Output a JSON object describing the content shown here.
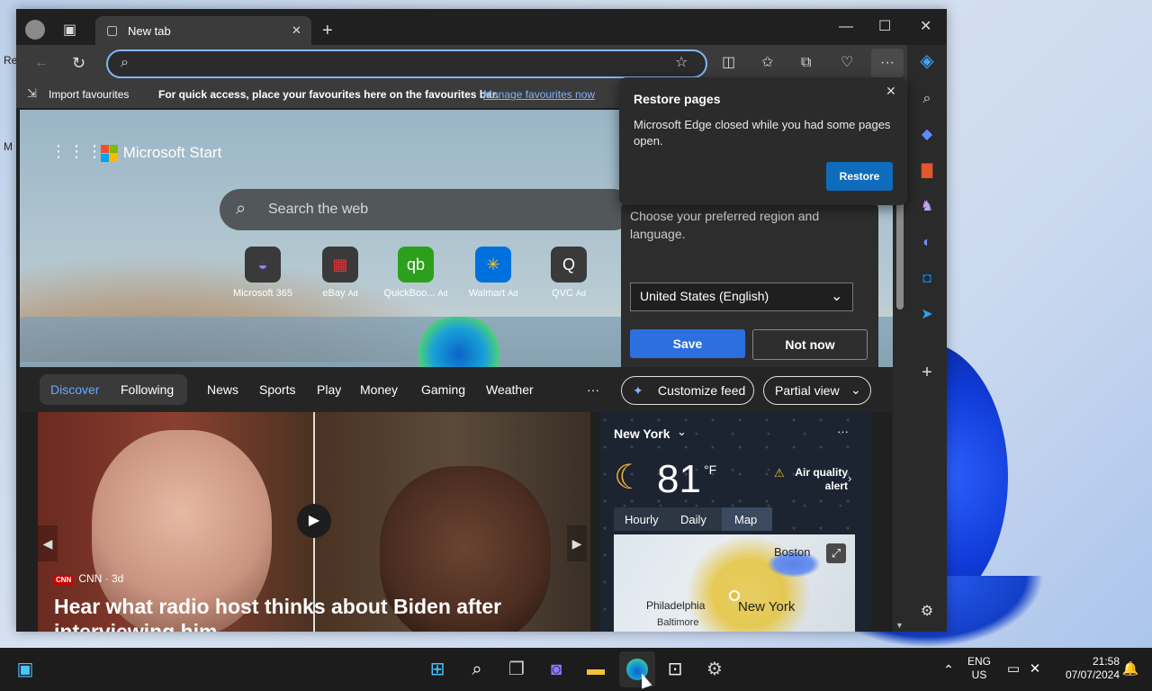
{
  "desktop": {
    "icon_labels": [
      "Re",
      "M"
    ]
  },
  "browser": {
    "tab": {
      "title": "New tab"
    },
    "address": {
      "placeholder": ""
    },
    "favbar": {
      "import_label": "Import favourites",
      "hint": "For quick access, place your favourites here on the favourites bar.",
      "manage_link": "Manage favourites now"
    }
  },
  "page": {
    "brand": "Microsoft Start",
    "search_placeholder": "Search the web",
    "tiles": [
      {
        "label": "Microsoft 365",
        "icon": "m365-icon",
        "ad": ""
      },
      {
        "label": "eBay",
        "icon": "ebay-icon",
        "ad": "Ad"
      },
      {
        "label": "QuickBoo...",
        "icon": "quickbooks-icon",
        "ad": "Ad"
      },
      {
        "label": "Walmart",
        "icon": "walmart-icon",
        "ad": "Ad"
      },
      {
        "label": "QVC",
        "icon": "qvc-icon",
        "ad": "Ad"
      }
    ],
    "region_popup": {
      "text": "Choose your preferred region and language.",
      "selected": "United States (English)",
      "save": "Save",
      "not_now": "Not now"
    },
    "restore_popup": {
      "title": "Restore pages",
      "message": "Microsoft Edge closed while you had some pages open.",
      "button": "Restore"
    },
    "feed_nav": {
      "items": [
        "Discover",
        "Following",
        "News",
        "Sports",
        "Play",
        "Money",
        "Gaming",
        "Weather"
      ],
      "more": "···",
      "customize": "Customize feed",
      "view": "Partial view"
    },
    "hero": {
      "source": "CNN · 3d",
      "source_logo": "CNN",
      "headline": "Hear what radio host thinks about Biden after interviewing him"
    },
    "weather": {
      "city": "New York",
      "temp": "81",
      "unit": "°F",
      "alert": "Air quality alert",
      "tabs": [
        "Hourly",
        "Daily",
        "Map"
      ],
      "map_labels": [
        "Boston",
        "Philadelphia",
        "New York",
        "Baltimore"
      ]
    }
  },
  "taskbar": {
    "lang_top": "ENG",
    "lang_bottom": "US",
    "time": "21:58",
    "date": "07/07/2024"
  },
  "colors": {
    "accent": "#0f6cbd",
    "save": "#2b6fe0",
    "link": "#7fb5ff"
  }
}
